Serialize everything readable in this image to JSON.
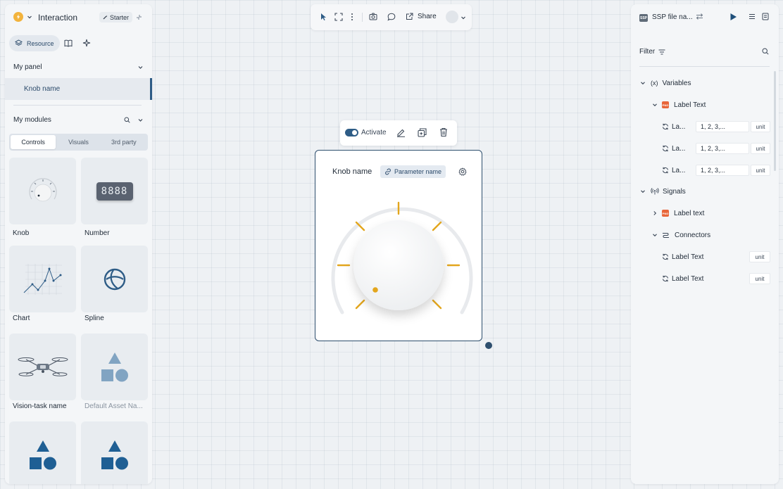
{
  "left_panel": {
    "app_title": "Interaction",
    "starter_label": "Starter",
    "resource_label": "Resource",
    "my_panel_label": "My panel",
    "knob_item_label": "Knob name",
    "my_modules_label": "My modules",
    "tabs": [
      "Controls",
      "Visuals",
      "3rd party"
    ],
    "active_tab": "Controls",
    "modules": [
      {
        "label": "Knob",
        "icon": "knob-icon"
      },
      {
        "label": "Number",
        "icon": "number-display-icon",
        "display": "8888"
      },
      {
        "label": "Chart",
        "icon": "line-chart-icon"
      },
      {
        "label": "Spline",
        "icon": "spline-globe-icon"
      },
      {
        "label": "Vision-task name",
        "icon": "drone-icon"
      },
      {
        "label": "Default Asset Na...",
        "icon": "shapes-icon"
      },
      {
        "label": "",
        "icon": "shapes-icon"
      },
      {
        "label": "",
        "icon": "shapes-icon"
      }
    ]
  },
  "toolbar": {
    "share_label": "Share"
  },
  "action_bar": {
    "activate_label": "Activate",
    "activated": true
  },
  "knob_card": {
    "title": "Knob name",
    "parameter_label": "Parameter name",
    "knob_value_fraction": 0.15
  },
  "right_panel": {
    "file_badge": "SSP",
    "file_title": "SSP file na...",
    "filter_label": "Filter",
    "variables": {
      "label": "Variables",
      "group_label": "Label Text",
      "rows": [
        {
          "label": "La...",
          "value": "1, 2, 3,...",
          "unit": "unit"
        },
        {
          "label": "La...",
          "value": "1, 2, 3,...",
          "unit": "unit"
        },
        {
          "label": "La...",
          "value": "1, 2, 3,...",
          "unit": "unit"
        }
      ]
    },
    "signals": {
      "label": "Signals",
      "group_label": "Label text",
      "connectors_label": "Connectors",
      "rows": [
        {
          "label": "Label Text",
          "unit": "unit"
        },
        {
          "label": "Label Text",
          "unit": "unit"
        }
      ]
    }
  },
  "colors": {
    "accent": "#2e5c86",
    "knob_tick": "#e3a61d",
    "png_badge": "#e8663a",
    "logo": "#f2b33d"
  }
}
